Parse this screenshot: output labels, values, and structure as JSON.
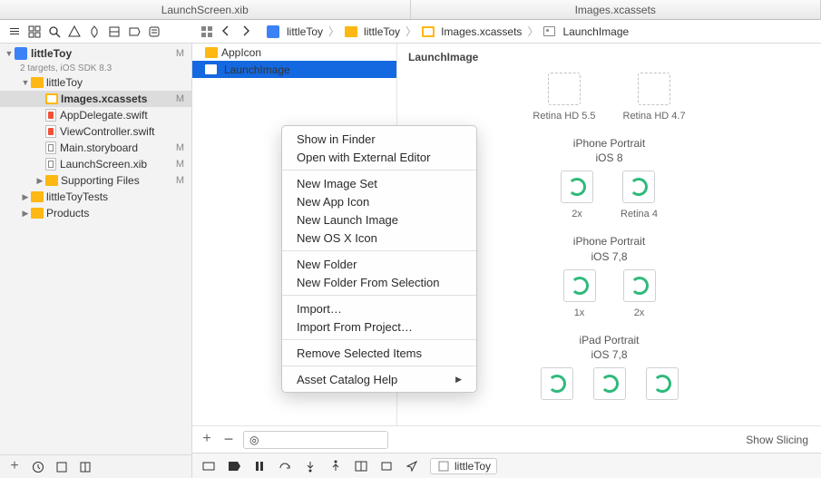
{
  "tabs": [
    "LaunchScreen.xib",
    "Images.xcassets"
  ],
  "breadcrumbs": [
    {
      "icon": "proj",
      "label": "littleToy"
    },
    {
      "icon": "folder",
      "label": "littleToy"
    },
    {
      "icon": "asset",
      "label": "Images.xcassets"
    },
    {
      "icon": "image",
      "label": "LaunchImage"
    }
  ],
  "project": {
    "name": "littleToy",
    "subtitle": "2 targets, iOS SDK 8.3",
    "flag": "M"
  },
  "tree": [
    {
      "indent": 1,
      "disclose": "down",
      "icon": "folder",
      "label": "littleToy"
    },
    {
      "indent": 2,
      "icon": "asset",
      "label": "Images.xcassets",
      "flag": "M",
      "selected": true
    },
    {
      "indent": 2,
      "icon": "swift",
      "label": "AppDelegate.swift"
    },
    {
      "indent": 2,
      "icon": "swift",
      "label": "ViewController.swift"
    },
    {
      "indent": 2,
      "icon": "sb",
      "label": "Main.storyboard",
      "flag": "M"
    },
    {
      "indent": 2,
      "icon": "sb",
      "label": "LaunchScreen.xib",
      "flag": "M"
    },
    {
      "indent": 2,
      "disclose": "right",
      "icon": "folder",
      "label": "Supporting Files",
      "flag": "M"
    },
    {
      "indent": 1,
      "disclose": "right",
      "icon": "folder",
      "label": "littleToyTests"
    },
    {
      "indent": 1,
      "disclose": "right",
      "icon": "folder",
      "label": "Products"
    }
  ],
  "outline": [
    {
      "icon": "folder",
      "label": "AppIcon"
    },
    {
      "icon": "image",
      "label": "LaunchImage",
      "selected": true
    }
  ],
  "editor": {
    "title": "LaunchImage",
    "sections": [
      {
        "label": "",
        "wells": [
          {
            "type": "empty",
            "sublabel": "Retina HD 5.5"
          },
          {
            "type": "empty",
            "sublabel": "Retina HD 4.7"
          }
        ],
        "caption": ""
      },
      {
        "caption": "iPhone Portrait\niOS 8",
        "wells": [
          {
            "type": "fill",
            "sublabel": "2x"
          },
          {
            "type": "fill",
            "sublabel": "Retina 4"
          }
        ]
      },
      {
        "caption": "iPhone Portrait\niOS 7,8",
        "wells": [
          {
            "type": "fill",
            "sublabel": "1x"
          },
          {
            "type": "fill",
            "sublabel": "2x"
          }
        ]
      },
      {
        "caption": "iPad Portrait\niOS 7,8",
        "wells": [
          {
            "type": "fill",
            "sublabel": ""
          },
          {
            "type": "fill",
            "sublabel": ""
          },
          {
            "type": "fill",
            "sublabel": ""
          }
        ]
      }
    ],
    "footer": {
      "show_slicing": "Show Slicing"
    }
  },
  "context_menu": [
    {
      "label": "Show in Finder"
    },
    {
      "label": "Open with External Editor"
    },
    {
      "sep": true
    },
    {
      "label": "New Image Set"
    },
    {
      "label": "New App Icon"
    },
    {
      "label": "New Launch Image"
    },
    {
      "label": "New OS X Icon"
    },
    {
      "sep": true
    },
    {
      "label": "New Folder"
    },
    {
      "label": "New Folder From Selection"
    },
    {
      "sep": true
    },
    {
      "label": "Import…"
    },
    {
      "label": "Import From Project…"
    },
    {
      "sep": true
    },
    {
      "label": "Remove Selected Items"
    },
    {
      "sep": true
    },
    {
      "label": "Asset Catalog Help",
      "submenu": true
    }
  ],
  "bottom": {
    "jump": "littleToy"
  }
}
